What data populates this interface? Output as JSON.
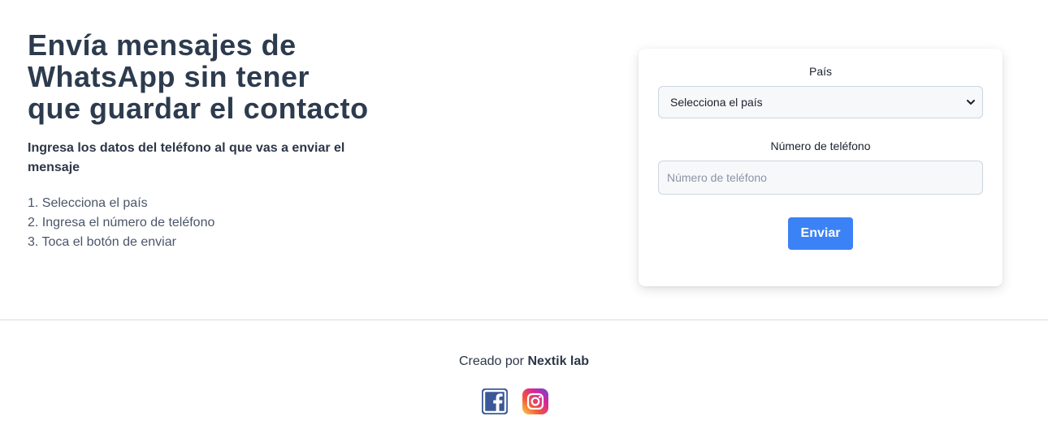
{
  "hero": {
    "title": "Envía mensajes de WhatsApp sin tener que guardar el contacto",
    "subtitle": "Ingresa los datos del teléfono al que vas a enviar el mensaje",
    "steps": [
      "1. Selecciona el país",
      "2. Ingresa el número de teléfono",
      "3. Toca el botón de enviar"
    ]
  },
  "form": {
    "country_label": "País",
    "country_selected": "Selecciona el país",
    "phone_label": "Número de teléfono",
    "phone_placeholder": "Número de teléfono",
    "phone_value": "",
    "submit_label": "Enviar"
  },
  "footer": {
    "credit_prefix": "Creado por",
    "credit_name": "Nextik lab",
    "socials": [
      "facebook-icon",
      "instagram-icon"
    ]
  },
  "colors": {
    "accent": "#3b82f6",
    "heading": "#2d3b4e",
    "facebook": "#3b5998"
  }
}
